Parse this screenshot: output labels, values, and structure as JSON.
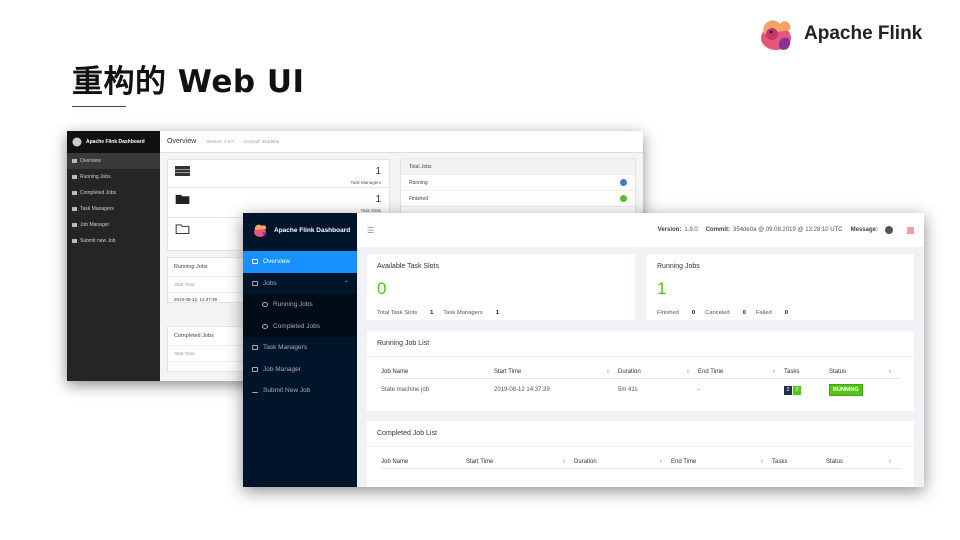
{
  "slide": {
    "title": "重构的 Web UI",
    "brand": "Apache Flink"
  },
  "old_dashboard": {
    "brand": "Apache Flink Dashboard",
    "nav": [
      "Overview",
      "Running Jobs",
      "Completed Jobs",
      "Task Managers",
      "Job Manager",
      "Submit new Job"
    ],
    "header_title": "Overview",
    "version": "Version: 1.9.0",
    "commit": "Commit: 354de0a",
    "stats": [
      {
        "value": "1",
        "label": "Task Managers"
      },
      {
        "value": "1",
        "label": "Task Slots"
      }
    ],
    "total_jobs": {
      "title": "Total Jobs",
      "rows": [
        "Running",
        "Finished"
      ]
    },
    "running_jobs": {
      "title": "Running Jobs",
      "col": "Start Time",
      "value": "2019-08-12, 14:37:39"
    },
    "completed_jobs": {
      "title": "Completed Jobs",
      "col": "Start Time"
    }
  },
  "new_dashboard": {
    "brand": "Apache Flink Dashboard",
    "nav": [
      {
        "label": "Overview"
      },
      {
        "label": "Jobs"
      },
      {
        "label": "Running Jobs"
      },
      {
        "label": "Completed Jobs"
      },
      {
        "label": "Task Managers"
      },
      {
        "label": "Job Manager"
      },
      {
        "label": "Submit New Job"
      }
    ],
    "header": {
      "version_label": "Version:",
      "version": "1.9.0",
      "commit_label": "Commit:",
      "commit": "354de0a @ 09.08.2019 @ 13:28:10 UTC",
      "message_label": "Message:",
      "message_count": "0"
    },
    "slots_card": {
      "title": "Available Task Slots",
      "value": "0",
      "total_label": "Total Task Slots",
      "total": "1",
      "tm_label": "Task Managers",
      "tm": "1"
    },
    "running_card": {
      "title": "Running Jobs",
      "value": "1",
      "finished_label": "Finished",
      "finished": "0",
      "canceled_label": "Canceled",
      "canceled": "0",
      "failed_label": "Failed",
      "failed": "0"
    },
    "running_list": {
      "title": "Running Job List",
      "columns": [
        "Job Name",
        "Start Time",
        "Duration",
        "End Time",
        "Tasks",
        "Status"
      ],
      "rows": [
        {
          "name": "State machine job",
          "start": "2019-08-12 14:37:39",
          "duration": "5m 41s",
          "end": "-",
          "tasks_a": "2",
          "tasks_b": "2",
          "status": "RUNNING"
        }
      ]
    },
    "completed_list": {
      "title": "Completed Job List",
      "columns": [
        "Job Name",
        "Start Time",
        "Duration",
        "End Time",
        "Tasks",
        "Status"
      ]
    }
  },
  "colors": {
    "sidebar_new": "#001529",
    "accent": "#1890ff",
    "success": "#52c41a",
    "sidebar_old": "#252525"
  }
}
